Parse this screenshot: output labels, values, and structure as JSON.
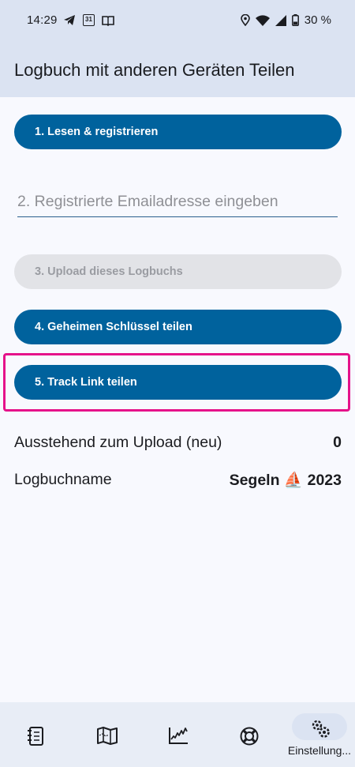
{
  "status_bar": {
    "time": "14:29",
    "calendar_day": "31",
    "battery": "30 %",
    "icons": [
      "telegram-icon",
      "calendar-icon",
      "book-icon",
      "location-icon",
      "wifi-icon",
      "signal-icon",
      "battery-icon"
    ]
  },
  "app_bar": {
    "title": "Logbuch mit anderen Geräten Teilen"
  },
  "steps": {
    "read_register": "1. Lesen & registrieren",
    "email_placeholder": "2. Registrierte Emailadresse eingeben",
    "email_value": "",
    "upload": "3. Upload dieses Logbuchs",
    "share_key": "4. Geheimen Schlüssel teilen",
    "share_track": "5. Track Link teilen"
  },
  "info": {
    "pending_label": "Ausstehend zum Upload (neu)",
    "pending_value": "0",
    "logbook_label": "Logbuchname",
    "logbook_value": "Segeln ⛵ 2023"
  },
  "nav": {
    "items": [
      {
        "icon": "logbook-icon",
        "label": ""
      },
      {
        "icon": "map-icon",
        "label": ""
      },
      {
        "icon": "chart-icon",
        "label": ""
      },
      {
        "icon": "lifebuoy-icon",
        "label": ""
      },
      {
        "icon": "settings-icon",
        "label": "Einstellung..."
      }
    ],
    "active_index": 4
  },
  "colors": {
    "primary": "#00629d",
    "surface": "#f8f9fe",
    "appbar": "#dbe3f2",
    "highlight": "#e5128a",
    "disabled": "#e2e3e7"
  }
}
